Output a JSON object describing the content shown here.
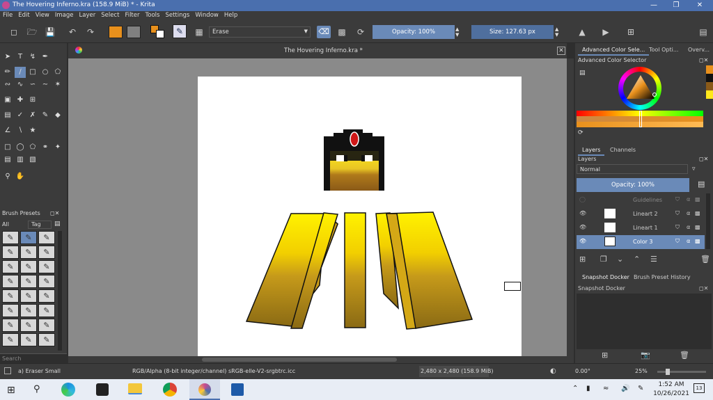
{
  "window": {
    "title": "The Hovering Inferno.kra (158.9 MiB)  * - Krita"
  },
  "menu": [
    "File",
    "Edit",
    "View",
    "Image",
    "Layer",
    "Select",
    "Filter",
    "Tools",
    "Settings",
    "Window",
    "Help"
  ],
  "toolbar": {
    "blend_mode": "Erase",
    "opacity_label": "Opacity: 100%",
    "size_label": "Size: 127.63 px",
    "fg_color": "#e8901c",
    "bg_color": "#808080"
  },
  "document": {
    "tab_title": "The Hovering Inferno.kra *"
  },
  "brush_presets": {
    "title": "Brush Presets",
    "filter": "All",
    "tag": "Tag",
    "search_placeholder": "Search"
  },
  "right_dock": {
    "tabs": [
      "Advanced Color Sele...",
      "Tool Opti...",
      "Overv..."
    ],
    "color_selector_title": "Advanced Color Selector",
    "layer_tabs": [
      "Layers",
      "Channels"
    ],
    "layers_title": "Layers",
    "blend": "Normal",
    "opacity": "Opacity:  100%",
    "layers": [
      {
        "name": "Guidelines",
        "selected": false,
        "dim": true
      },
      {
        "name": "Lineart 2",
        "selected": false,
        "dim": false
      },
      {
        "name": "Lineart 1",
        "selected": false,
        "dim": false
      },
      {
        "name": "Color 3",
        "selected": true,
        "dim": false
      }
    ],
    "bottom_tabs": [
      "Snapshot Docker",
      "Brush Preset History"
    ],
    "snapshot_title": "Snapshot Docker"
  },
  "status": {
    "brush": "a) Eraser Small",
    "color_space": "RGB/Alpha (8-bit integer/channel)  sRGB-elle-V2-srgbtrc.icc",
    "dimensions": "2,480 x 2,480 (158.9 MiB)",
    "rotation": "0.00°",
    "zoom": "25%"
  },
  "taskbar": {
    "time": "1:52 AM",
    "date": "10/26/2021",
    "notifications": "13"
  }
}
